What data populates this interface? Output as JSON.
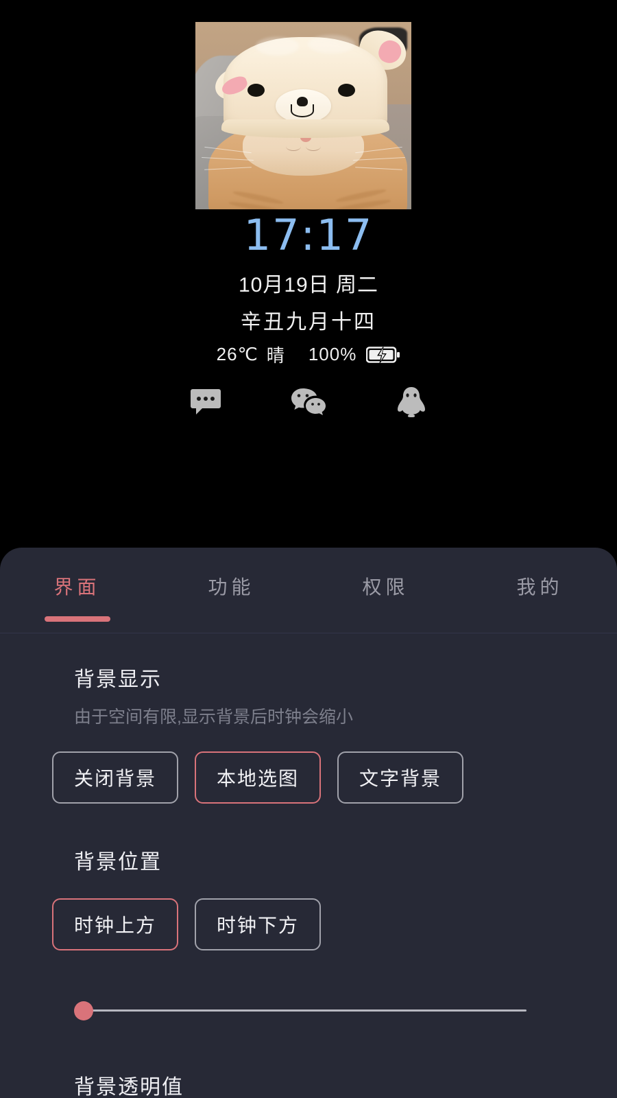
{
  "lockscreen": {
    "wallpaper": {
      "alt": "cat-wearing-bear-hat-photo",
      "subject": "orange tabby cat wearing cream bear hat with pink ears"
    },
    "clock": {
      "time": "17:17",
      "time_color": "#8cbdf0",
      "date": "10月19日 周二",
      "lunar": "辛丑九月十四",
      "temperature": "26℃",
      "weather": "晴",
      "battery_percent": "100%",
      "battery_icon": "battery-charging-icon"
    },
    "shortcuts": [
      {
        "name": "messages-icon",
        "label": "信息"
      },
      {
        "name": "wechat-icon",
        "label": "微信"
      },
      {
        "name": "qq-icon",
        "label": "QQ"
      }
    ]
  },
  "panel": {
    "accent_color": "#d9737a",
    "background_color": "#272936",
    "tabs": [
      {
        "label": "界面",
        "active": true
      },
      {
        "label": "功能",
        "active": false
      },
      {
        "label": "权限",
        "active": false
      },
      {
        "label": "我的",
        "active": false
      }
    ],
    "sections": [
      {
        "title": "背景显示",
        "subtitle": "由于空间有限,显示背景后时钟会缩小",
        "options": [
          {
            "label": "关闭背景",
            "selected": false
          },
          {
            "label": "本地选图",
            "selected": true
          },
          {
            "label": "文字背景",
            "selected": false
          }
        ]
      },
      {
        "title": "背景位置",
        "options": [
          {
            "label": "时钟上方",
            "selected": true
          },
          {
            "label": "时钟下方",
            "selected": false
          }
        ]
      }
    ],
    "slider": {
      "value": 0,
      "min": 0,
      "max": 100
    },
    "next_section_title": "背景透明值"
  }
}
